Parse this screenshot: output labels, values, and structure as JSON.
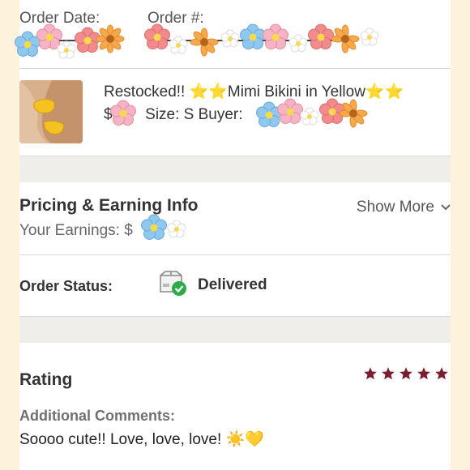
{
  "order": {
    "date_label": "Order Date:",
    "number_label": "Order #:"
  },
  "product": {
    "title": "Restocked!! ⭐⭐Mimi Bikini in Yellow⭐⭐",
    "price_prefix": "$",
    "size_text": "Size: S",
    "buyer_label": "Buyer:",
    "thumbnail": "product-photo"
  },
  "pricing": {
    "title": "Pricing & Earning Info",
    "show_more": "Show More",
    "earnings_label": "Your Earnings: $"
  },
  "status": {
    "label": "Order Status:",
    "value": "Delivered",
    "icon": "package-delivered-icon",
    "check_color": "#2eaa4a"
  },
  "rating": {
    "title": "Rating",
    "stars": 5,
    "star_color": "#7c1d2e",
    "comments_label": "Additional Comments:",
    "comment": "Soooo cute!! Love, love, love! ☀️💛"
  }
}
